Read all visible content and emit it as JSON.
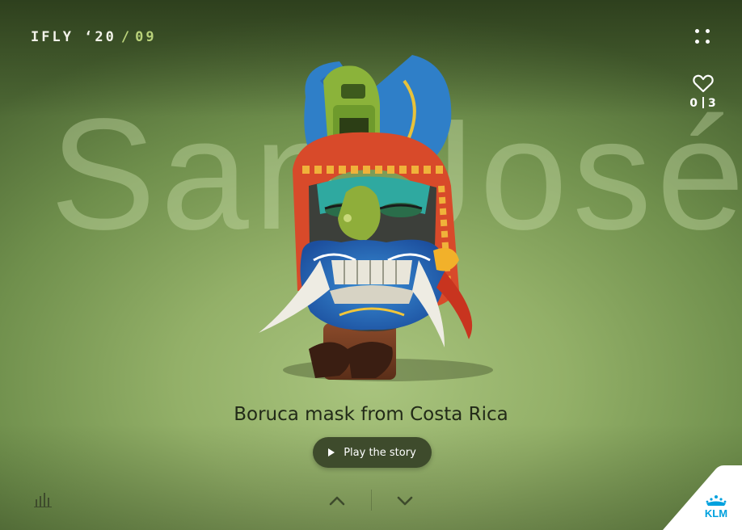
{
  "header": {
    "brand": "IFLY ‘20",
    "slash": "/",
    "issue": "09",
    "menu_icon": "grid-dots-icon"
  },
  "favorites": {
    "icon": "heart-icon",
    "count": "0",
    "total": "3"
  },
  "hero": {
    "city": "San José",
    "caption": "Boruca mask from Costa Rica",
    "image": "boruca-mask-illustration"
  },
  "actions": {
    "play_label": "Play the story",
    "play_icon": "play-icon"
  },
  "footer": {
    "audio_icon": "equalizer-icon",
    "prev_icon": "chevron-up-icon",
    "next_icon": "chevron-down-icon",
    "logo": "KLM"
  },
  "colors": {
    "background": "#93b068",
    "accent": "#b9d27a",
    "button": "#3e4b2c",
    "klm_blue": "#00a1de"
  }
}
